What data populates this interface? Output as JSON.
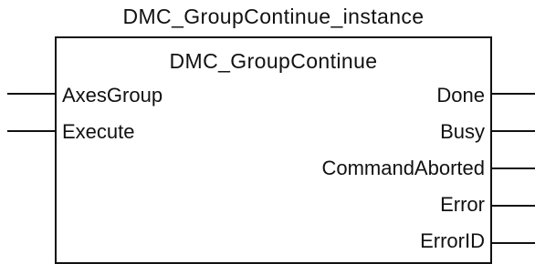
{
  "instance_name": "DMC_GroupContinue_instance",
  "block_name": "DMC_GroupContinue",
  "inputs": [
    {
      "label": "AxesGroup"
    },
    {
      "label": "Execute"
    }
  ],
  "outputs": [
    {
      "label": "Done"
    },
    {
      "label": "Busy"
    },
    {
      "label": "CommandAborted"
    },
    {
      "label": "Error"
    },
    {
      "label": "ErrorID"
    }
  ]
}
